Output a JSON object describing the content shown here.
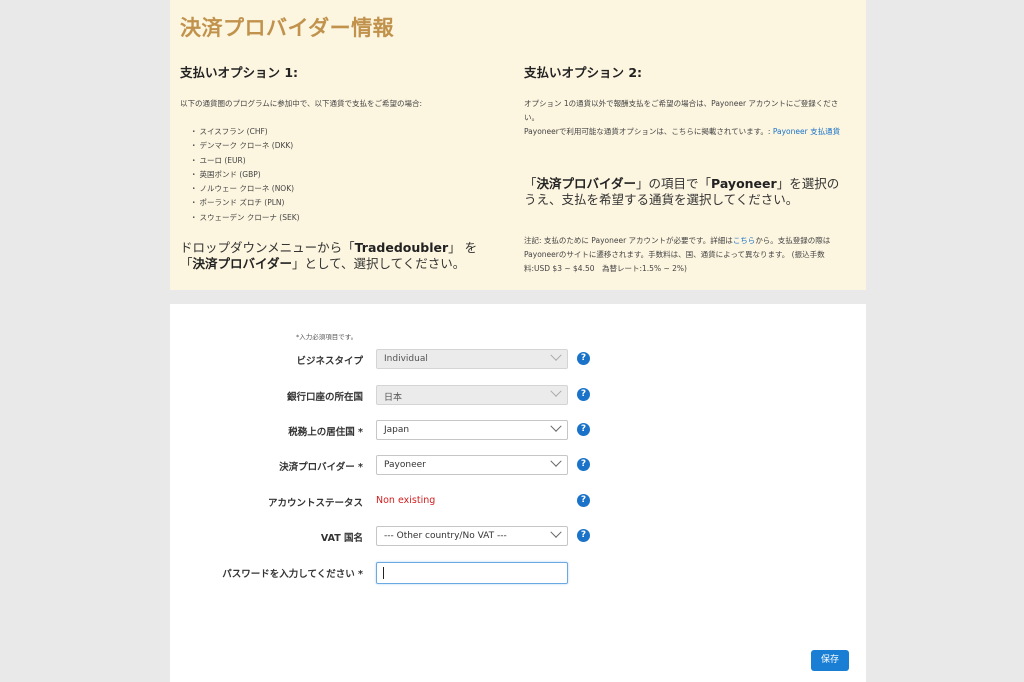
{
  "info": {
    "title": "決済プロバイダー情報",
    "option1": {
      "title": "支払いオプション 1:",
      "intro": "以下の通貨圏のプログラムに参加中で、以下通貨で支払をご希望の場合:",
      "currencies": [
        "スイスフラン (CHF)",
        "デンマーク クローネ (DKK)",
        "ユーロ (EUR)",
        "英国ポンド (GBP)",
        "ノルウェー クローネ (NOK)",
        "ポーランド ズロチ (PLN)",
        "スウェーデン クローナ (SEK)"
      ],
      "instruction_pre": "ドロップダウンメニューから「",
      "instruction_bold1": "Tradedoubler",
      "instruction_mid": "」 を「",
      "instruction_bold2": "決済プロバイダー",
      "instruction_post": "」として、選択してください。"
    },
    "option2": {
      "title": "支払いオプション 2:",
      "intro": "オプション 1の通貨以外で報酬支払をご希望の場合は、Payoneer アカウントにご登録ください。",
      "available_text": "Payoneerで利用可能な通貨オプションは、こちらに掲載されています。: ",
      "available_link": "Payoneer 支払通貨",
      "instruction_pre": "「",
      "instruction_bold1": "決済プロバイダー",
      "instruction_mid": "」の項目で「",
      "instruction_bold2": "Payoneer",
      "instruction_post": "」を選択のうえ、支払を希望する通貨を選択してください。",
      "note_pre": "注記: 支払のために Payoneer アカウントが必要です。詳細は",
      "note_link": "こちら",
      "note_post": "から。支払登録の際はPayoneerのサイトに遷移されます。手数料は、国、通貨によって異なります。 (振込手数料:USD $3 ~ $4.50　為替レート:1.5% ~ 2%)"
    }
  },
  "form": {
    "required_note": "*入力必須項目です。",
    "fields": [
      {
        "label": "ビジネスタイプ",
        "value": "Individual"
      },
      {
        "label": "銀行口座の所在国",
        "value": "日本"
      },
      {
        "label": "税務上の居住国 *",
        "value": "Japan"
      },
      {
        "label": "決済プロバイダー *",
        "value": "Payoneer"
      },
      {
        "label": "アカウントステータス",
        "value": "Non existing"
      },
      {
        "label": "VAT 国名",
        "value": "--- Other country/No VAT ---"
      },
      {
        "label": "パスワードを入力してください *",
        "value": ""
      }
    ],
    "help_glyph": "?",
    "save_label": "保存"
  },
  "colors": {
    "title": "#c1924c",
    "status_error": "#d31d1d",
    "accent": "#1a73c8"
  }
}
